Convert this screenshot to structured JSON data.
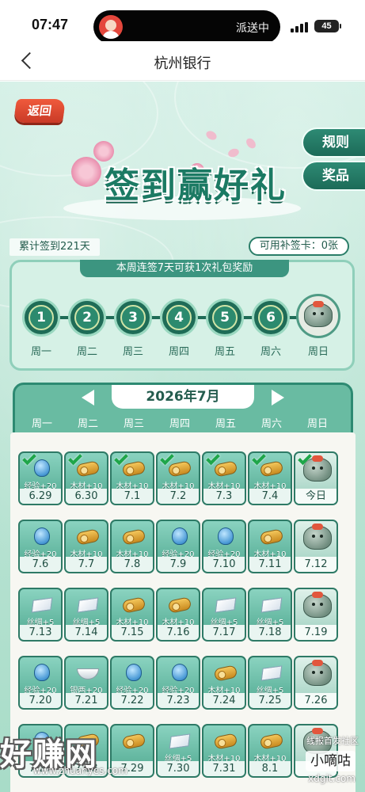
{
  "status": {
    "time": "07:47",
    "activity": "派送中",
    "battery": "45"
  },
  "nav": {
    "title": "杭州银行"
  },
  "page": {
    "back_label": "返回",
    "rules_label": "规则",
    "prizes_label": "奖品",
    "title": "签到赢好礼",
    "total_days": "累计签到221天",
    "makeup_cards": "可用补签卡：0张"
  },
  "week": {
    "banner": "本周连签7天可获1次礼包奖励",
    "days": [
      {
        "num": "1",
        "label": "周一"
      },
      {
        "num": "2",
        "label": "周二"
      },
      {
        "num": "3",
        "label": "周三"
      },
      {
        "num": "4",
        "label": "周四"
      },
      {
        "num": "5",
        "label": "周五"
      },
      {
        "num": "6",
        "label": "周六"
      },
      {
        "num": "",
        "label": "周日"
      }
    ]
  },
  "calendar": {
    "month": "2026年7月",
    "weekdays": [
      "周一",
      "周二",
      "周三",
      "周四",
      "周五",
      "周六",
      "周日"
    ],
    "rows": [
      [
        {
          "reward": "经验+20",
          "date": "6.29",
          "icon": "exp",
          "checked": true
        },
        {
          "reward": "木材+10",
          "date": "6.30",
          "icon": "wood",
          "checked": true
        },
        {
          "reward": "木材+10",
          "date": "7.1",
          "icon": "wood",
          "checked": true
        },
        {
          "reward": "木材+10",
          "date": "7.2",
          "icon": "wood",
          "checked": true
        },
        {
          "reward": "木材+10",
          "date": "7.3",
          "icon": "wood",
          "checked": true
        },
        {
          "reward": "木材+10",
          "date": "7.4",
          "icon": "wood",
          "checked": true
        },
        {
          "reward": "",
          "date": "今日",
          "icon": "bag",
          "checked": true
        }
      ],
      [
        {
          "reward": "经验+20",
          "date": "7.6",
          "icon": "exp",
          "checked": false
        },
        {
          "reward": "木材+10",
          "date": "7.7",
          "icon": "wood",
          "checked": false
        },
        {
          "reward": "木材+10",
          "date": "7.8",
          "icon": "wood",
          "checked": false
        },
        {
          "reward": "经验+20",
          "date": "7.9",
          "icon": "exp",
          "checked": false
        },
        {
          "reward": "经验+20",
          "date": "7.10",
          "icon": "exp",
          "checked": false
        },
        {
          "reward": "木材+10",
          "date": "7.11",
          "icon": "wood",
          "checked": false
        },
        {
          "reward": "",
          "date": "7.12",
          "icon": "bag",
          "checked": false
        }
      ],
      [
        {
          "reward": "丝绸+5",
          "date": "7.13",
          "icon": "silk",
          "checked": false
        },
        {
          "reward": "丝绸+5",
          "date": "7.14",
          "icon": "silk",
          "checked": false
        },
        {
          "reward": "木材+10",
          "date": "7.15",
          "icon": "wood",
          "checked": false
        },
        {
          "reward": "木材+10",
          "date": "7.16",
          "icon": "wood",
          "checked": false
        },
        {
          "reward": "丝绸+5",
          "date": "7.17",
          "icon": "silk",
          "checked": false
        },
        {
          "reward": "丝绸+5",
          "date": "7.18",
          "icon": "silk",
          "checked": false
        },
        {
          "reward": "",
          "date": "7.19",
          "icon": "bag",
          "checked": false
        }
      ],
      [
        {
          "reward": "经验+20",
          "date": "7.20",
          "icon": "exp",
          "checked": false
        },
        {
          "reward": "银两+20",
          "date": "7.21",
          "icon": "silver",
          "checked": false
        },
        {
          "reward": "经验+20",
          "date": "7.22",
          "icon": "exp",
          "checked": false
        },
        {
          "reward": "经验+20",
          "date": "7.23",
          "icon": "exp",
          "checked": false
        },
        {
          "reward": "木材+10",
          "date": "7.24",
          "icon": "wood",
          "checked": false
        },
        {
          "reward": "丝绸+5",
          "date": "7.25",
          "icon": "silk",
          "checked": false
        },
        {
          "reward": "",
          "date": "7.26",
          "icon": "bag",
          "checked": false
        }
      ],
      [
        {
          "reward": "",
          "date": "7.27",
          "icon": "exp",
          "checked": false
        },
        {
          "reward": "",
          "date": "7.28",
          "icon": "wood",
          "checked": false
        },
        {
          "reward": "",
          "date": "7.29",
          "icon": "wood",
          "checked": false
        },
        {
          "reward": "丝绸+5",
          "date": "7.30",
          "icon": "silk",
          "checked": false
        },
        {
          "reward": "木材+10",
          "date": "7.31",
          "icon": "wood",
          "checked": false
        },
        {
          "reward": "木材+10",
          "date": "8.1",
          "icon": "wood",
          "checked": false
        },
        {
          "reward": "",
          "date": "",
          "icon": "bag",
          "checked": false
        }
      ]
    ]
  },
  "watermark": {
    "main": "好赚网",
    "sub": "www.zhuanyes.com",
    "right_top": "线报首发社区",
    "right_box": "小嘀咕",
    "right_site": "xdgit.com"
  },
  "colors": {
    "accent": "#2d8a72",
    "back_button": "#e04a32",
    "check": "#1fa64a"
  }
}
